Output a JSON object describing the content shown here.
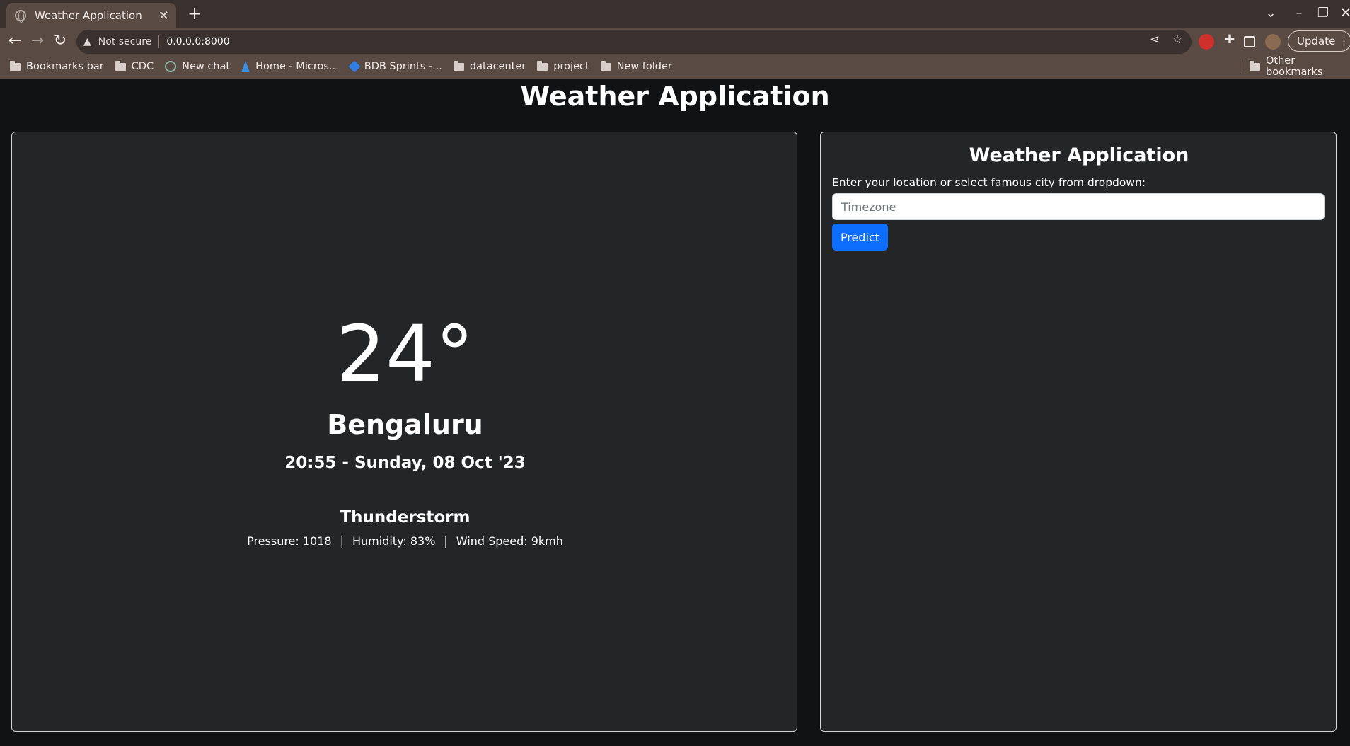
{
  "browser": {
    "tab_title": "Weather Application",
    "security_label": "Not secure",
    "url": "0.0.0.0:8000",
    "update_label": "Update",
    "bookmarks": [
      {
        "label": "Bookmarks bar",
        "icon": "folder-icon"
      },
      {
        "label": "CDC",
        "icon": "folder-icon"
      },
      {
        "label": "New chat",
        "icon": "chatgpt-icon"
      },
      {
        "label": "Home - Micros...",
        "icon": "azure-icon"
      },
      {
        "label": "BDB Sprints -...",
        "icon": "jira-icon"
      },
      {
        "label": "datacenter",
        "icon": "folder-icon"
      },
      {
        "label": "project",
        "icon": "folder-icon"
      },
      {
        "label": "New folder",
        "icon": "folder-icon"
      }
    ],
    "other_bookmarks": "Other bookmarks"
  },
  "page": {
    "title": "Weather Application"
  },
  "weather": {
    "temperature": "24°",
    "city": "Bengaluru",
    "datetime": "20:55 - Sunday, 08 Oct '23",
    "condition": "Thunderstorm",
    "pressure": "Pressure: 1018",
    "humidity": "Humidity: 83%",
    "wind": "Wind Speed: 9kmh"
  },
  "form": {
    "title": "Weather Application",
    "label": "Enter your location or select famous city from dropdown:",
    "placeholder": "Timezone",
    "button": "Predict"
  },
  "colors": {
    "page_bg": "#111213",
    "panel_bg": "#242526",
    "accent": "#0d6efd",
    "chrome": "#5a4a44"
  }
}
